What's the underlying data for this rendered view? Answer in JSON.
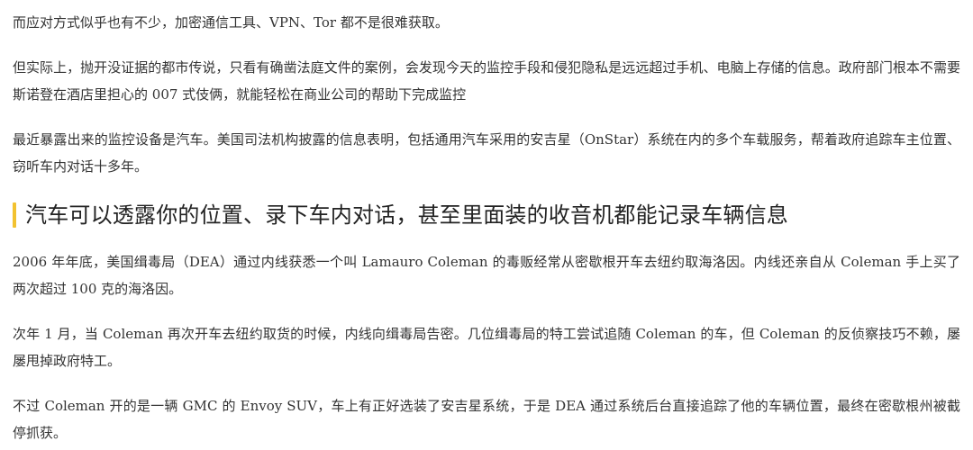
{
  "article": {
    "paragraphs_before": [
      "而应对方式似乎也有不少，加密通信工具、VPN、Tor 都不是很难获取。",
      "但实际上，抛开没证据的都市传说，只看有确凿法庭文件的案例，会发现今天的监控手段和侵犯隐私是远远超过手机、电脑上存储的信息。政府部门根本不需要斯诺登在酒店里担心的 007 式伎俩，就能轻松在商业公司的帮助下完成监控",
      "最近暴露出来的监控设备是汽车。美国司法机构披露的信息表明，包括通用汽车采用的安吉星（OnStar）系统在内的多个车载服务，帮着政府追踪车主位置、窃听车内对话十多年。"
    ],
    "heading": "汽车可以透露你的位置、录下车内对话，甚至里面装的收音机都能记录车辆信息",
    "paragraphs_after": [
      "2006 年年底，美国缉毒局（DEA）通过内线获悉一个叫 Lamauro Coleman 的毒贩经常从密歇根开车去纽约取海洛因。内线还亲自从 Coleman 手上买了两次超过 100 克的海洛因。",
      "次年 1 月，当 Coleman 再次开车去纽约取货的时候，内线向缉毒局告密。几位缉毒局的特工尝试追随 Coleman 的车，但 Coleman 的反侦察技巧不赖，屡屡甩掉政府特工。",
      "不过 Coleman 开的是一辆 GMC 的 Envoy SUV，车上有正好选装了安吉星系统，于是 DEA 通过系统后台直接追踪了他的车辆位置，最终在密歇根州被截停抓获。"
    ],
    "accent_color": "#f2c230"
  }
}
